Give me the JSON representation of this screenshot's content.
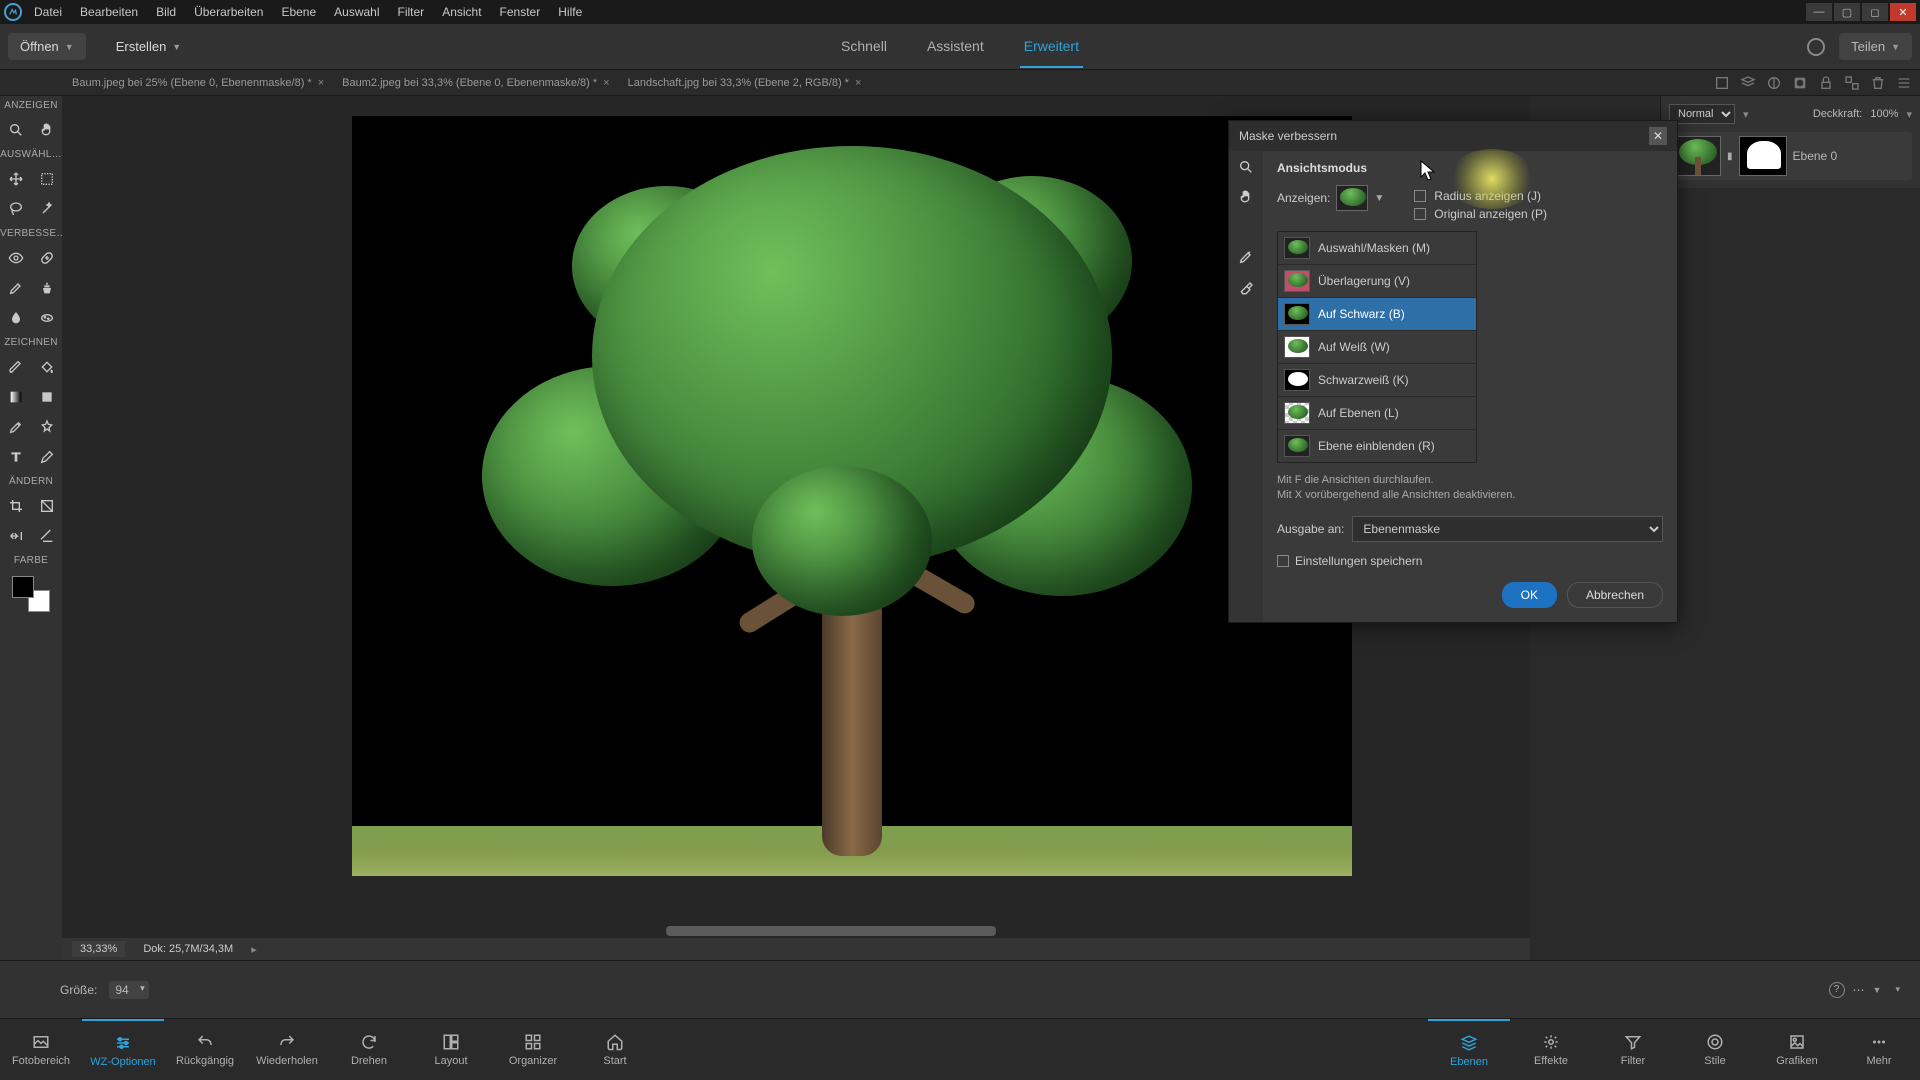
{
  "window": {
    "menu": [
      "Datei",
      "Bearbeiten",
      "Bild",
      "Überarbeiten",
      "Ebene",
      "Auswahl",
      "Filter",
      "Ansicht",
      "Fenster",
      "Hilfe"
    ]
  },
  "topbar": {
    "open": "Öffnen",
    "create": "Erstellen",
    "share": "Teilen"
  },
  "modes": {
    "quick": "Schnell",
    "guided": "Assistent",
    "expert": "Erweitert"
  },
  "tabs": [
    "Baum.jpeg bei 25% (Ebene 0, Ebenenmaske/8) *",
    "Baum2.jpeg bei 33,3% (Ebene 0, Ebenenmaske/8) *",
    "Landschaft.jpg bei 33,3% (Ebene 2, RGB/8) *"
  ],
  "layers": {
    "blendmode": "Normal",
    "opacity_label": "Deckkraft:",
    "opacity": "100%",
    "entry_name": "Ebene 0"
  },
  "toolbox": {
    "h_view": "ANZEIGEN",
    "h_select": "AUSWÄHL…",
    "h_enhance": "VERBESSE…",
    "h_draw": "ZEICHNEN",
    "h_modify": "ÄNDERN",
    "h_color": "FARBE"
  },
  "dialog": {
    "title": "Maske verbessern",
    "section_view": "Ansichtsmodus",
    "show_label": "Anzeigen:",
    "radius_show": "Radius anzeigen (J)",
    "original_show": "Original anzeigen (P)",
    "options": {
      "marching": "Auswahl/Masken (M)",
      "overlay": "Überlagerung (V)",
      "onblack": "Auf Schwarz (B)",
      "onwhite": "Auf Weiß (W)",
      "bw": "Schwarzweiß (K)",
      "onlayers": "Auf Ebenen (L)",
      "reveal": "Ebene einblenden (R)"
    },
    "hint1": "Mit F die Ansichten durchlaufen.",
    "hint2": "Mit X vorübergehend alle Ansichten deaktivieren.",
    "output_label": "Ausgabe an:",
    "output_value": "Ebenenmaske",
    "save_settings": "Einstellungen speichern",
    "ok": "OK",
    "cancel": "Abbrechen"
  },
  "status": {
    "zoom": "33,33%",
    "doc": "Dok: 25,7M/34,3M"
  },
  "optionsbar": {
    "size_label": "Größe:",
    "size_value": "94"
  },
  "bottombar": {
    "left": {
      "photobin": "Fotobereich",
      "tooloptions": "WZ-Optionen",
      "undo": "Rückgängig",
      "redo": "Wiederholen",
      "rotate": "Drehen",
      "layout": "Layout",
      "organizer": "Organizer",
      "home": "Start"
    },
    "right": {
      "layers": "Ebenen",
      "effects": "Effekte",
      "filter": "Filter",
      "styles": "Stile",
      "graphics": "Grafiken",
      "more": "Mehr"
    }
  }
}
